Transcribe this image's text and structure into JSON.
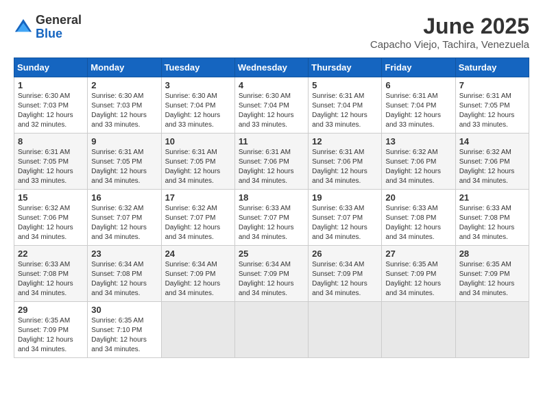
{
  "logo": {
    "general": "General",
    "blue": "Blue"
  },
  "title": "June 2025",
  "location": "Capacho Viejo, Tachira, Venezuela",
  "days_header": [
    "Sunday",
    "Monday",
    "Tuesday",
    "Wednesday",
    "Thursday",
    "Friday",
    "Saturday"
  ],
  "weeks": [
    [
      {
        "day": "1",
        "sunrise": "6:30 AM",
        "sunset": "7:03 PM",
        "daylight": "12 hours and 32 minutes."
      },
      {
        "day": "2",
        "sunrise": "6:30 AM",
        "sunset": "7:03 PM",
        "daylight": "12 hours and 33 minutes."
      },
      {
        "day": "3",
        "sunrise": "6:30 AM",
        "sunset": "7:04 PM",
        "daylight": "12 hours and 33 minutes."
      },
      {
        "day": "4",
        "sunrise": "6:30 AM",
        "sunset": "7:04 PM",
        "daylight": "12 hours and 33 minutes."
      },
      {
        "day": "5",
        "sunrise": "6:31 AM",
        "sunset": "7:04 PM",
        "daylight": "12 hours and 33 minutes."
      },
      {
        "day": "6",
        "sunrise": "6:31 AM",
        "sunset": "7:04 PM",
        "daylight": "12 hours and 33 minutes."
      },
      {
        "day": "7",
        "sunrise": "6:31 AM",
        "sunset": "7:05 PM",
        "daylight": "12 hours and 33 minutes."
      }
    ],
    [
      {
        "day": "8",
        "sunrise": "6:31 AM",
        "sunset": "7:05 PM",
        "daylight": "12 hours and 33 minutes."
      },
      {
        "day": "9",
        "sunrise": "6:31 AM",
        "sunset": "7:05 PM",
        "daylight": "12 hours and 34 minutes."
      },
      {
        "day": "10",
        "sunrise": "6:31 AM",
        "sunset": "7:05 PM",
        "daylight": "12 hours and 34 minutes."
      },
      {
        "day": "11",
        "sunrise": "6:31 AM",
        "sunset": "7:06 PM",
        "daylight": "12 hours and 34 minutes."
      },
      {
        "day": "12",
        "sunrise": "6:31 AM",
        "sunset": "7:06 PM",
        "daylight": "12 hours and 34 minutes."
      },
      {
        "day": "13",
        "sunrise": "6:32 AM",
        "sunset": "7:06 PM",
        "daylight": "12 hours and 34 minutes."
      },
      {
        "day": "14",
        "sunrise": "6:32 AM",
        "sunset": "7:06 PM",
        "daylight": "12 hours and 34 minutes."
      }
    ],
    [
      {
        "day": "15",
        "sunrise": "6:32 AM",
        "sunset": "7:06 PM",
        "daylight": "12 hours and 34 minutes."
      },
      {
        "day": "16",
        "sunrise": "6:32 AM",
        "sunset": "7:07 PM",
        "daylight": "12 hours and 34 minutes."
      },
      {
        "day": "17",
        "sunrise": "6:32 AM",
        "sunset": "7:07 PM",
        "daylight": "12 hours and 34 minutes."
      },
      {
        "day": "18",
        "sunrise": "6:33 AM",
        "sunset": "7:07 PM",
        "daylight": "12 hours and 34 minutes."
      },
      {
        "day": "19",
        "sunrise": "6:33 AM",
        "sunset": "7:07 PM",
        "daylight": "12 hours and 34 minutes."
      },
      {
        "day": "20",
        "sunrise": "6:33 AM",
        "sunset": "7:08 PM",
        "daylight": "12 hours and 34 minutes."
      },
      {
        "day": "21",
        "sunrise": "6:33 AM",
        "sunset": "7:08 PM",
        "daylight": "12 hours and 34 minutes."
      }
    ],
    [
      {
        "day": "22",
        "sunrise": "6:33 AM",
        "sunset": "7:08 PM",
        "daylight": "12 hours and 34 minutes."
      },
      {
        "day": "23",
        "sunrise": "6:34 AM",
        "sunset": "7:08 PM",
        "daylight": "12 hours and 34 minutes."
      },
      {
        "day": "24",
        "sunrise": "6:34 AM",
        "sunset": "7:09 PM",
        "daylight": "12 hours and 34 minutes."
      },
      {
        "day": "25",
        "sunrise": "6:34 AM",
        "sunset": "7:09 PM",
        "daylight": "12 hours and 34 minutes."
      },
      {
        "day": "26",
        "sunrise": "6:34 AM",
        "sunset": "7:09 PM",
        "daylight": "12 hours and 34 minutes."
      },
      {
        "day": "27",
        "sunrise": "6:35 AM",
        "sunset": "7:09 PM",
        "daylight": "12 hours and 34 minutes."
      },
      {
        "day": "28",
        "sunrise": "6:35 AM",
        "sunset": "7:09 PM",
        "daylight": "12 hours and 34 minutes."
      }
    ],
    [
      {
        "day": "29",
        "sunrise": "6:35 AM",
        "sunset": "7:09 PM",
        "daylight": "12 hours and 34 minutes."
      },
      {
        "day": "30",
        "sunrise": "6:35 AM",
        "sunset": "7:10 PM",
        "daylight": "12 hours and 34 minutes."
      },
      null,
      null,
      null,
      null,
      null
    ]
  ],
  "labels": {
    "sunrise": "Sunrise:",
    "sunset": "Sunset:",
    "daylight": "Daylight:"
  }
}
